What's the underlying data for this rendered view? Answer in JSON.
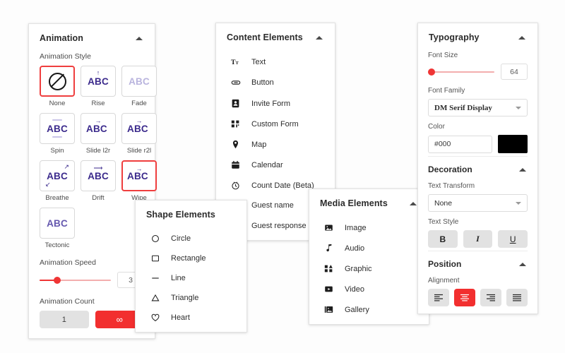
{
  "animation_panel": {
    "title": "Animation",
    "style_label": "Animation Style",
    "styles": [
      {
        "label": "None",
        "icon": "no-entry-icon",
        "selected": true
      },
      {
        "label": "Rise",
        "icon": "arrow-up-icon",
        "selected": false
      },
      {
        "label": "Fade",
        "icon": "fade-text-icon",
        "selected": false
      },
      {
        "label": "Spin",
        "icon": "spin-text-icon",
        "selected": false
      },
      {
        "label": "Slide l2r",
        "icon": "arrow-right-icon",
        "selected": false
      },
      {
        "label": "Slide r2l",
        "icon": "arrow-right-icon",
        "selected": false
      },
      {
        "label": "Breathe",
        "icon": "diagonal-arrows-icon",
        "selected": false
      },
      {
        "label": "Drift",
        "icon": "long-arrow-right-icon",
        "selected": false
      },
      {
        "label": "Wipe",
        "icon": "arrow-right-icon",
        "selected": true
      },
      {
        "label": "Tectonic",
        "icon": "blur-text-icon",
        "selected": false
      }
    ],
    "tile_text": "ABC",
    "speed_label": "Animation Speed",
    "speed_value": "3",
    "speed_percent": 25,
    "count_label": "Animation Count",
    "count_once": "1",
    "count_infinite": "∞"
  },
  "content_panel": {
    "title": "Content Elements",
    "items": [
      {
        "label": "Text",
        "icon": "text-format-icon"
      },
      {
        "label": "Button",
        "icon": "button-icon"
      },
      {
        "label": "Invite Form",
        "icon": "invite-form-icon"
      },
      {
        "label": "Custom Form",
        "icon": "custom-form-icon"
      },
      {
        "label": "Map",
        "icon": "map-pin-icon"
      },
      {
        "label": "Calendar",
        "icon": "calendar-icon"
      },
      {
        "label": "Count Date (Beta)",
        "icon": "clock-icon"
      },
      {
        "label": "Guest name",
        "icon": "rsvp-icon"
      },
      {
        "label": "Guest response",
        "icon": "people-icon"
      }
    ]
  },
  "shape_panel": {
    "title": "Shape Elements",
    "items": [
      {
        "label": "Circle",
        "icon": "circle-icon"
      },
      {
        "label": "Rectangle",
        "icon": "square-icon"
      },
      {
        "label": "Line",
        "icon": "line-icon"
      },
      {
        "label": "Triangle",
        "icon": "triangle-icon"
      },
      {
        "label": "Heart",
        "icon": "heart-icon"
      }
    ]
  },
  "media_panel": {
    "title": "Media Elements",
    "items": [
      {
        "label": "Image",
        "icon": "image-icon"
      },
      {
        "label": "Audio",
        "icon": "music-note-icon"
      },
      {
        "label": "Graphic",
        "icon": "graphic-icon"
      },
      {
        "label": "Video",
        "icon": "video-icon"
      },
      {
        "label": "Gallery",
        "icon": "gallery-icon"
      }
    ]
  },
  "typography_panel": {
    "title": "Typography",
    "font_size_label": "Font Size",
    "font_size_value": "64",
    "font_size_percent": 5,
    "font_family_label": "Font Family",
    "font_family_value": "DM Serif Display",
    "color_label": "Color",
    "color_value": "#000",
    "color_swatch": "#000000",
    "decoration": {
      "title": "Decoration",
      "text_transform_label": "Text Transform",
      "text_transform_value": "None",
      "text_style_label": "Text Style",
      "bold": "B",
      "italic": "I",
      "underline": "U"
    },
    "position": {
      "title": "Position",
      "alignment_label": "Alignment",
      "options": [
        "align-left",
        "align-center",
        "align-right",
        "align-justify"
      ],
      "selected": "align-center"
    }
  },
  "colors": {
    "accent_red": "#f22f2f",
    "slider_red": "#ef3535",
    "tile_text_purple": "#3b2a8c",
    "panel_border": "#e3e3e3"
  }
}
